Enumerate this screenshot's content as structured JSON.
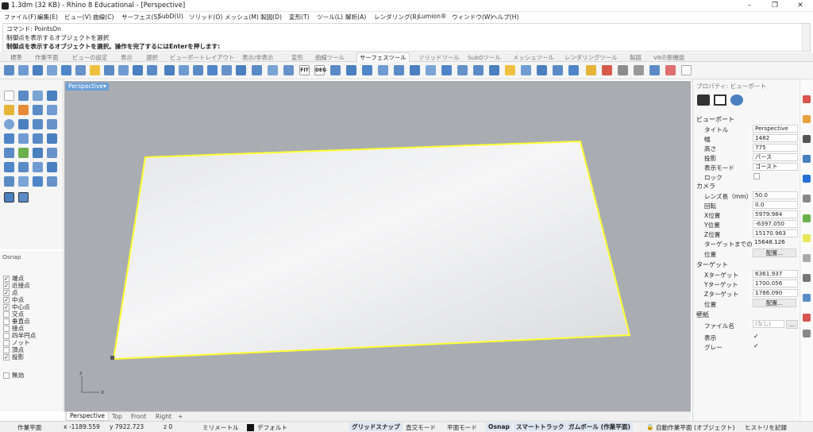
{
  "title_bar": {
    "text": "1.3dm (32 KB) - Rhino 8 Educational - [Perspective]",
    "minimize": "–",
    "maximize": "❐",
    "close": "✕"
  },
  "menu": [
    "ファイル(F)",
    "編集(E)",
    "ビュー(V)",
    "曲線(C)",
    "サーフェス(S)",
    "SubD(U)",
    "ソリッド(O)",
    "メッシュ(M)",
    "製図(D)",
    "変形(T)",
    "ツール(L)",
    "解析(A)",
    "レンダリング(R)",
    "Lumion®",
    "ウィンドウ(W)",
    "ヘルプ(H)"
  ],
  "command": {
    "line1": "コマンド: PointsOn",
    "line2": "制御点を表示するオブジェクトを選択",
    "line3": "制御点を表示するオブジェクトを選択。操作を完了するにはEnterを押します:"
  },
  "toolbar_tabs": [
    "標準",
    "作業平面",
    "ビューの設定",
    "表示",
    "選択",
    "ビューポートレイアウト",
    "表示/非表示",
    "変形",
    "曲線ツール",
    "サーフェスツール",
    "ソリッドツール",
    "SubDツール",
    "メッシュツール",
    "レンダリングツール",
    "製図",
    "V8の新機能"
  ],
  "active_tab": "サーフェスツール",
  "toolbar_text_icons": {
    "fit": "FIT",
    "deg": "DEG"
  },
  "viewport": {
    "label": "Perspective",
    "dropdown": "▾",
    "axis_x": "x",
    "axis_z": "z"
  },
  "viewport_tabs": [
    "Perspective",
    "Top",
    "Front",
    "Right"
  ],
  "viewport_tab_add": "+",
  "osnap": {
    "header": "Osnap",
    "items": [
      {
        "label": "端点",
        "checked": "✓"
      },
      {
        "label": "近接点",
        "checked": "✓"
      },
      {
        "label": "点",
        "checked": "✓"
      },
      {
        "label": "中点",
        "checked": "✓"
      },
      {
        "label": "中心点",
        "checked": "✓"
      },
      {
        "label": "交点",
        "checked": ""
      },
      {
        "label": "垂直点",
        "checked": ""
      },
      {
        "label": "接点",
        "checked": ""
      },
      {
        "label": "四半円点",
        "checked": ""
      },
      {
        "label": "ノット",
        "checked": ""
      },
      {
        "label": "頂点",
        "checked": ""
      },
      {
        "label": "投影",
        "checked": "✓"
      }
    ],
    "disable": {
      "label": "無効",
      "checked": ""
    }
  },
  "properties": {
    "title": "プロパティ: ビューポート",
    "viewport_section": "ビューポート",
    "viewport_rows": [
      {
        "label": "タイトル",
        "value": "Perspective"
      },
      {
        "label": "幅",
        "value": "1482"
      },
      {
        "label": "高さ",
        "value": "775"
      },
      {
        "label": "投影",
        "value": "パース"
      },
      {
        "label": "表示モード",
        "value": "ゴースト"
      }
    ],
    "lock_label": "ロック",
    "camera_section": "カメラ",
    "camera_rows": [
      {
        "label": "レンズ長（mm）",
        "value": "50.0"
      },
      {
        "label": "回転",
        "value": "0.0"
      },
      {
        "label": "X位置",
        "value": "5979.984"
      },
      {
        "label": "Y位置",
        "value": "-6397.050"
      },
      {
        "label": "Z位置",
        "value": "15170.963"
      },
      {
        "label": "ターゲットまでの",
        "value": "15648.126"
      }
    ],
    "position_label": "位置",
    "place_button": "配置...",
    "target_section": "ターゲット",
    "target_rows": [
      {
        "label": "Xターゲット",
        "value": "6361.937"
      },
      {
        "label": "Yターゲット",
        "value": "1700.056"
      },
      {
        "label": "Zターゲット",
        "value": "1786.090"
      }
    ],
    "target_position_label": "位置",
    "target_place_button": "配置...",
    "wallpaper_section": "壁紙",
    "filename_label": "ファイル名",
    "filename_value": "(なし)",
    "browse_button": "...",
    "show_label": "表示",
    "show_checked": "✓",
    "gray_label": "グレー",
    "gray_checked": "✓"
  },
  "status": {
    "cplane": "作業平面",
    "x": "x -1189.559",
    "y": "y 7922.723",
    "z": "z 0",
    "units": "ミリメートル",
    "layer": "デフォルト",
    "grid_snap": "グリッドスナップ",
    "ortho": "直交モード",
    "planar": "平面モード",
    "osnap": "Osnap",
    "smarttrack": "スマートトラック",
    "gumball": "ガムボール (作業平面)",
    "lock_icon": "🔒",
    "autoalign": "自動作業平面 (オブジェクト)",
    "history": "ヒストリを記録"
  },
  "colors": {
    "viewport_bg": "#a9adb2",
    "selection": "#ffff33",
    "accent": "#6aa0d8"
  }
}
